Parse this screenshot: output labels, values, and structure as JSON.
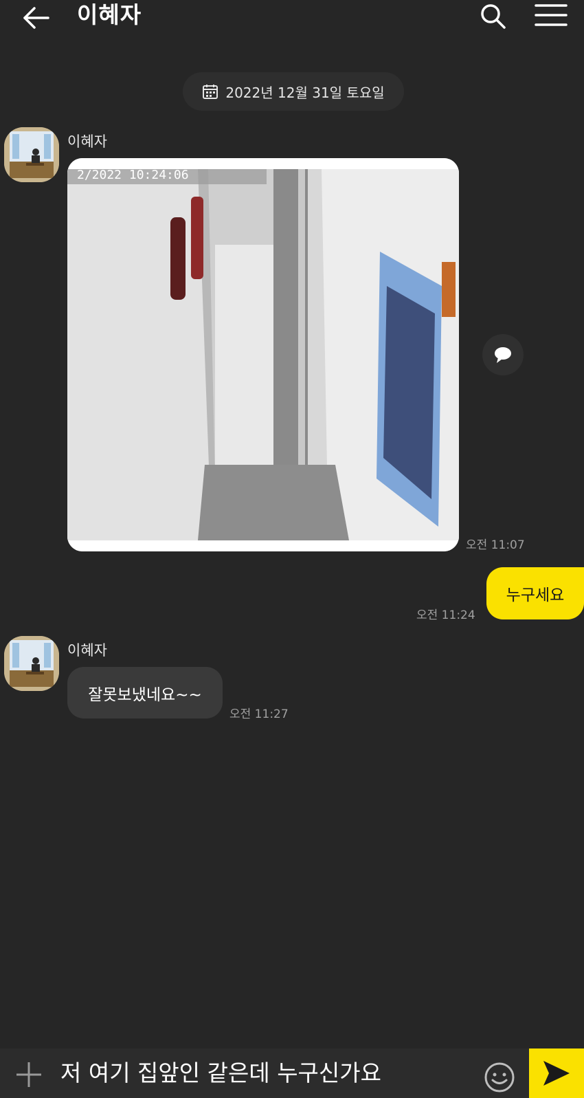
{
  "header": {
    "title": "이혜자",
    "back_icon": "arrow-left-icon",
    "search_icon": "search-icon",
    "menu_icon": "hamburger-menu-icon"
  },
  "date_divider": {
    "label": "2022년 12월 31일 토요일",
    "icon": "calendar-icon"
  },
  "messages": [
    {
      "type": "image",
      "sender": "이혜자",
      "time": "오전 11:07",
      "image_overlay_text": "2/2022 10:24:06"
    },
    {
      "type": "text",
      "mine": true,
      "text": "누구세요",
      "time": "오전 11:24"
    },
    {
      "type": "text",
      "sender": "이혜자",
      "text": "잘못보냈네요~~",
      "time": "오전 11:27"
    }
  ],
  "input": {
    "value": "저 여기 집앞인 같은데 누구신가요",
    "plus_icon": "plus-icon",
    "emoji_icon": "emoji-icon",
    "send_icon": "send-icon"
  },
  "colors": {
    "background": "#262626",
    "my_bubble": "#fae100",
    "their_bubble": "#3a3a3a",
    "send_button": "#fae100"
  }
}
